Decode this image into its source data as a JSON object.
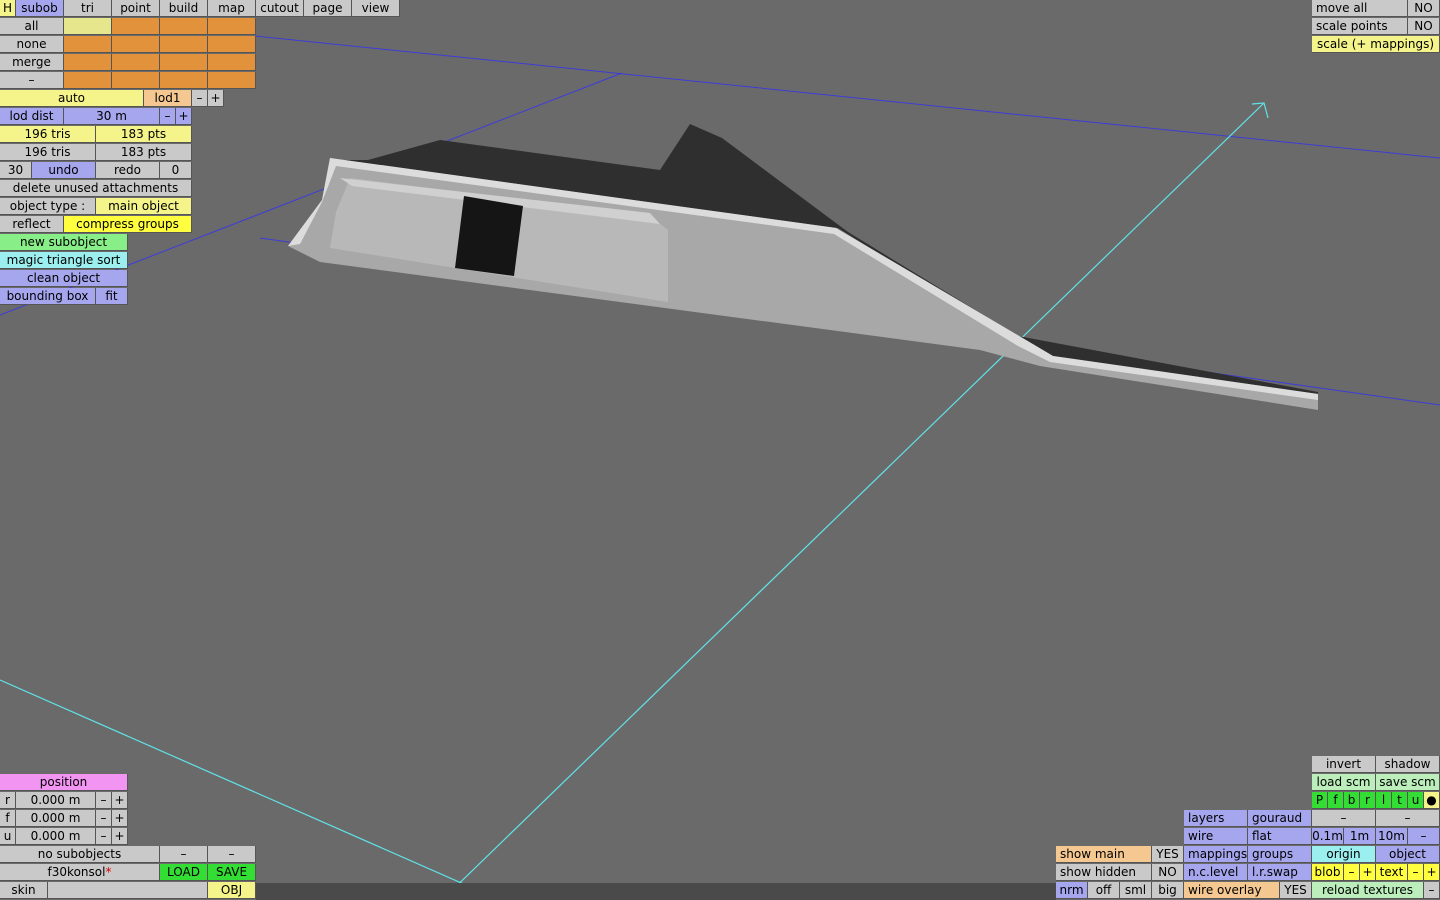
{
  "top_tabs": [
    "H",
    "subob",
    "tri",
    "point",
    "build",
    "map",
    "cutout",
    "page",
    "view"
  ],
  "select_rows": [
    "all",
    "none",
    "merge",
    "–"
  ],
  "lod": {
    "auto": "auto",
    "level": "lod1",
    "minus": "–",
    "plus": "+"
  },
  "lod_dist": {
    "label": "lod dist",
    "value": "30 m",
    "minus": "–",
    "plus": "+"
  },
  "stats": [
    [
      "196 tris",
      "183 pts"
    ],
    [
      "196 tris",
      "183 pts"
    ]
  ],
  "undo_row": {
    "count": "30",
    "undo": "undo",
    "redo": "redo",
    "redo_count": "0"
  },
  "delete_unused": "delete unused attachments",
  "object_type": {
    "label": "object type :",
    "value": "main object"
  },
  "reflect": "reflect",
  "compress_groups": "compress groups",
  "new_subobject": "new subobject",
  "magic_sort": "magic triangle sort",
  "clean_object": "clean object",
  "bounding_box": {
    "label": "bounding box",
    "fit": "fit"
  },
  "top_right": {
    "move_all": {
      "label": "move all",
      "value": "NO"
    },
    "scale_points": {
      "label": "scale points",
      "value": "NO"
    },
    "scale_mappings": "scale (+ mappings)"
  },
  "position": {
    "title": "position",
    "rows": [
      {
        "axis": "r",
        "value": "0.000 m"
      },
      {
        "axis": "f",
        "value": "0.000 m"
      },
      {
        "axis": "u",
        "value": "0.000 m"
      }
    ],
    "minus": "–",
    "plus": "+"
  },
  "subobjects": {
    "label": "no subobjects",
    "a": "–",
    "b": "–"
  },
  "file": {
    "name": "f30konsol",
    "modified": "*",
    "load": "LOAD",
    "save": "SAVE"
  },
  "skin": {
    "label": "skin",
    "obj": "OBJ"
  },
  "view_opts": {
    "show_main": {
      "label": "show main",
      "value": "YES"
    },
    "show_hidden": {
      "label": "show hidden",
      "value": "NO"
    },
    "nrm": "nrm",
    "off": "off",
    "sml": "sml",
    "big": "big"
  },
  "render": {
    "layers": "layers",
    "gouraud": "gouraud",
    "wire": "wire",
    "flat": "flat",
    "mappings": "mappings",
    "groups": "groups",
    "nclevel": "n.c.level",
    "lrswap": "l.r.swap",
    "wire_overlay": "wire overlay",
    "wire_overlay_value": "YES"
  },
  "br": {
    "invert": "invert",
    "shadow": "shadow",
    "load_scm": "load scm",
    "save_scm": "save scm",
    "channels": [
      "P",
      "f",
      "b",
      "r",
      "l",
      "t",
      "u",
      "●"
    ],
    "dash1": "–",
    "dash2": "–",
    "grid": [
      "0.1m",
      "1m",
      "10m",
      "–"
    ],
    "origin": "origin",
    "object": "object",
    "blob": "blob",
    "text": "text",
    "minus": "–",
    "plus": "+",
    "reload": "reload textures",
    "last": "–"
  },
  "colors": {
    "viewport": "#6b6a6a",
    "axis_blue": "#3c3cd8",
    "axis_cyan": "#5fe3e8"
  }
}
